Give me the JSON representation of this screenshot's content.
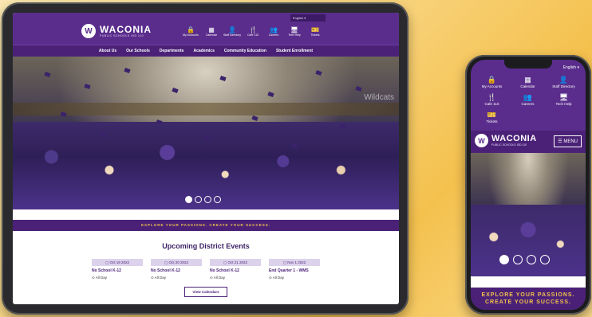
{
  "tablet": {
    "language_label": "English",
    "logo_mark": "W",
    "logo_name": "WACONIA",
    "logo_sub": "PUBLIC SCHOOLS ISD 110",
    "quick_links": [
      {
        "icon": "lock-icon",
        "glyph": "🔒",
        "label": "My Accounts"
      },
      {
        "icon": "calendar-icon",
        "glyph": "▦",
        "label": "Calendar"
      },
      {
        "icon": "person-icon",
        "glyph": "👤",
        "label": "Staff Directory"
      },
      {
        "icon": "fork-knife-icon",
        "glyph": "🍴",
        "label": "Cafe 110"
      },
      {
        "icon": "people-plus-icon",
        "glyph": "👥",
        "label": "Careers"
      },
      {
        "icon": "monitor-icon",
        "glyph": "🖥",
        "label": "Tech Help"
      },
      {
        "icon": "ticket-icon",
        "glyph": "🎫",
        "label": "Tickets"
      }
    ],
    "nav": [
      "About Us",
      "Our Schools",
      "Departments",
      "Academics",
      "Community Education",
      "Student Enrollment"
    ],
    "hero_watermark": "Wildcats",
    "banner": "EXPLORE YOUR PASSIONS. CREATE YOUR SUCCESS.",
    "events_title": "Upcoming District Events",
    "events": [
      {
        "date": "Oct 19 2022",
        "name": "No School K-12",
        "time": "All Day"
      },
      {
        "date": "Oct 20 2022",
        "name": "No School K-12",
        "time": "All Day"
      },
      {
        "date": "Oct 21 2022",
        "name": "No School K-12",
        "time": "All Day"
      },
      {
        "date": "Nov 1 2022",
        "name": "End Quarter 1 - WMS",
        "time": "All Day"
      }
    ],
    "button_label": "View Calendars",
    "slides": 4,
    "active_slide": 1
  },
  "phone": {
    "language_label": "English",
    "quick_links": [
      {
        "icon": "lock-icon",
        "glyph": "🔒",
        "label": "My Accounts"
      },
      {
        "icon": "calendar-icon",
        "glyph": "▦",
        "label": "Calendar"
      },
      {
        "icon": "person-icon",
        "glyph": "👤",
        "label": "Staff Directory"
      },
      {
        "icon": "fork-knife-icon",
        "glyph": "🍴",
        "label": "Cafe 110"
      },
      {
        "icon": "people-plus-icon",
        "glyph": "👥",
        "label": "Careers"
      },
      {
        "icon": "monitor-icon",
        "glyph": "🖥",
        "label": "Tech Help"
      },
      {
        "icon": "ticket-icon",
        "glyph": "🎫",
        "label": "Tickets"
      }
    ],
    "logo_mark": "W",
    "logo_name": "WACONIA",
    "logo_sub": "PUBLIC SCHOOLS ISD 110",
    "menu_label": "☰ MENU",
    "banner_line1": "EXPLORE YOUR PASSIONS.",
    "banner_line2": "CREATE YOUR SUCCESS."
  },
  "colors": {
    "purple": "#5a2d8c",
    "dark_purple": "#4b2178",
    "gold": "#f1c24a"
  }
}
